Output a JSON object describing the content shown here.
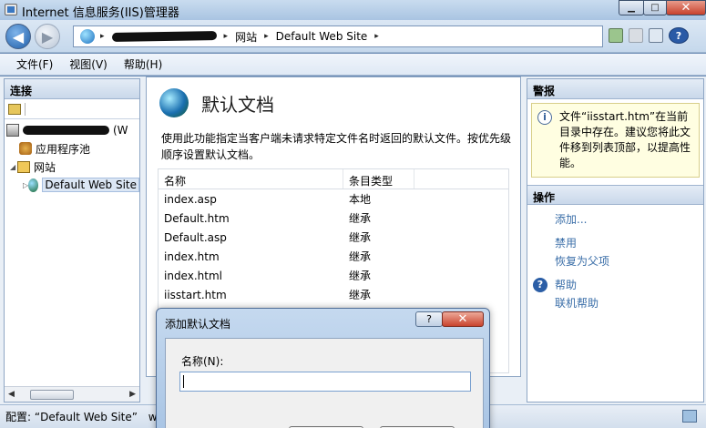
{
  "window": {
    "title": "Internet 信息服务(IIS)管理器",
    "controls": {
      "minimize": "▁",
      "maximize": "□",
      "close": "✕"
    }
  },
  "address": {
    "segments": [
      "网站",
      "Default Web Site"
    ],
    "separator": "▸"
  },
  "menu": [
    "文件(F)",
    "视图(V)",
    "帮助(H)"
  ],
  "connections": {
    "header": "连接",
    "server_suffix": "(W",
    "tree": [
      {
        "label": "应用程序池",
        "icon": "app-pool-icon"
      },
      {
        "label": "网站",
        "icon": "sites-folder-icon"
      },
      {
        "label": "Default Web Site",
        "icon": "globe-icon",
        "selected": true
      }
    ]
  },
  "feature": {
    "title": "默认文档",
    "description": "使用此功能指定当客户端未请求特定文件名时返回的默认文件。按优先级顺序设置默认文档。",
    "columns": [
      "名称",
      "条目类型"
    ],
    "rows": [
      {
        "name": "index.asp",
        "type": "本地"
      },
      {
        "name": "Default.htm",
        "type": "继承"
      },
      {
        "name": "Default.asp",
        "type": "继承"
      },
      {
        "name": "index.htm",
        "type": "继承"
      },
      {
        "name": "index.html",
        "type": "继承"
      },
      {
        "name": "iisstart.htm",
        "type": "继承"
      }
    ]
  },
  "actions": {
    "header": "警报",
    "alert_text": "文件“iisstart.htm”在当前目录中存在。建议您将此文件移到列表顶部，以提高性能。",
    "section": "操作",
    "links_group1": [
      "添加..."
    ],
    "links_group2": [
      "禁用",
      "恢复为父项"
    ],
    "links_group3": [
      "帮助",
      "联机帮助"
    ]
  },
  "status": {
    "text": "配置: “Default Web Site”",
    "trailing": "we"
  },
  "dialog": {
    "title": "添加默认文档",
    "help": "?",
    "close": "✕",
    "field_label": "名称(N):",
    "field_value": ""
  }
}
